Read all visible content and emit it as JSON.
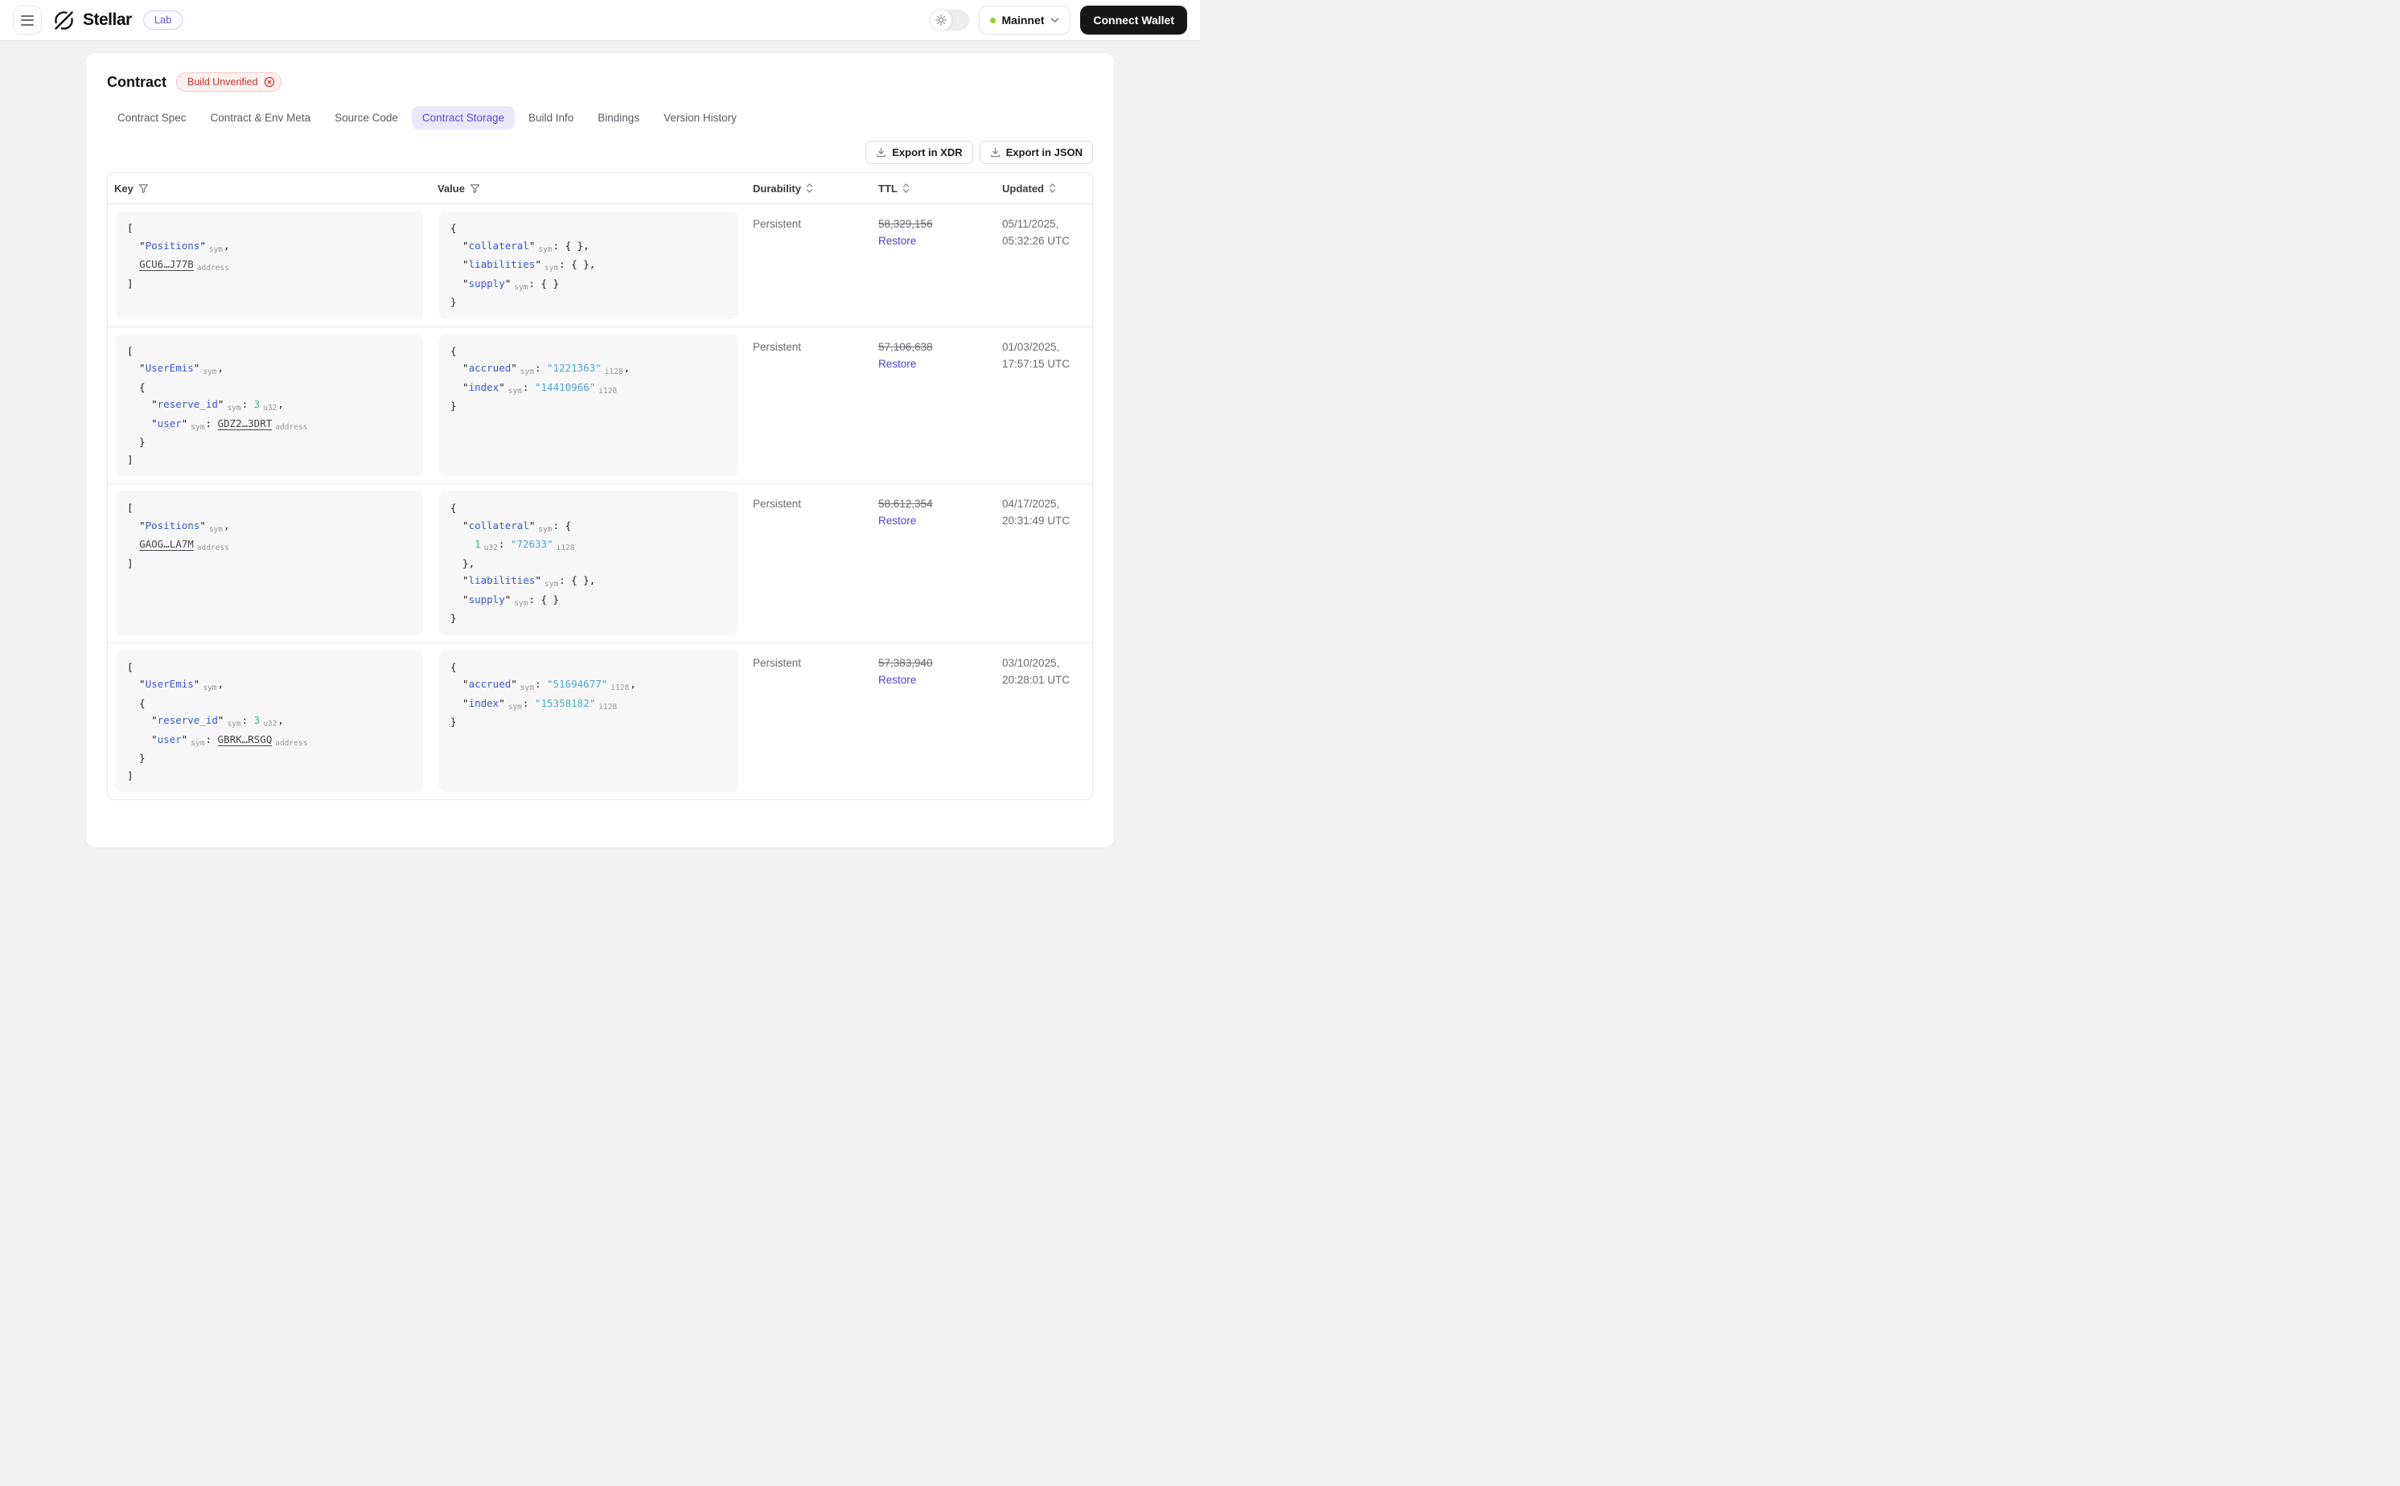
{
  "colors": {
    "accent_purple": "#5b49d6",
    "tab_active_bg": "#ece8fc",
    "key_blue": "#3a57c9",
    "string_cyan": "#4da6c9",
    "number_green": "#38b886",
    "restore_indigo": "#5143cb",
    "error_red": "#c1352f",
    "network_dot_green": "#94cf33",
    "wallet_button_bg": "#161616",
    "code_panel_bg": "#f7f7f7"
  },
  "header": {
    "brand": "Stellar",
    "badge": "Lab",
    "network_label": "Mainnet",
    "connect_wallet_label": "Connect Wallet"
  },
  "page": {
    "title": "Contract",
    "status_badge": "Build Unverified"
  },
  "tabs": {
    "items": [
      {
        "label": "Contract Spec"
      },
      {
        "label": "Contract & Env Meta"
      },
      {
        "label": "Source Code"
      },
      {
        "label": "Contract Storage"
      },
      {
        "label": "Build Info"
      },
      {
        "label": "Bindings"
      },
      {
        "label": "Version History"
      }
    ],
    "active": "Contract Storage"
  },
  "toolbar": {
    "export_xdr_label": "Export in XDR",
    "export_json_label": "Export in JSON"
  },
  "table": {
    "columns": [
      "Key",
      "Value",
      "Durability",
      "TTL",
      "Updated"
    ],
    "restore_label": "Restore",
    "rows": [
      {
        "key": [
          [
            [
              "p",
              "["
            ]
          ],
          [
            [
              "p",
              "  \""
            ],
            [
              "k",
              "Positions"
            ],
            [
              "p",
              "\""
            ],
            [
              "a",
              "sym"
            ],
            [
              "p",
              ","
            ]
          ],
          [
            [
              "p",
              "  "
            ],
            [
              "l",
              "GCU6…J77B"
            ],
            [
              "a",
              "address"
            ]
          ],
          [
            [
              "p",
              "]"
            ]
          ]
        ],
        "value": [
          [
            [
              "p",
              "{"
            ]
          ],
          [
            [
              "p",
              "  \""
            ],
            [
              "k",
              "collateral"
            ],
            [
              "p",
              "\""
            ],
            [
              "a",
              "sym"
            ],
            [
              "p",
              ": { },"
            ]
          ],
          [
            [
              "p",
              "  \""
            ],
            [
              "k",
              "liabilities"
            ],
            [
              "p",
              "\""
            ],
            [
              "a",
              "sym"
            ],
            [
              "p",
              ": { },"
            ]
          ],
          [
            [
              "p",
              "  \""
            ],
            [
              "k",
              "supply"
            ],
            [
              "p",
              "\""
            ],
            [
              "a",
              "sym"
            ],
            [
              "p",
              ": { }"
            ]
          ],
          [
            [
              "p",
              "}"
            ]
          ]
        ],
        "durability": "Persistent",
        "ttl": "58,329,156",
        "updated": [
          "05/11/2025,",
          "05:32:26 UTC"
        ]
      },
      {
        "key": [
          [
            [
              "p",
              "["
            ]
          ],
          [
            [
              "p",
              "  \""
            ],
            [
              "k",
              "UserEmis"
            ],
            [
              "p",
              "\""
            ],
            [
              "a",
              "sym"
            ],
            [
              "p",
              ","
            ]
          ],
          [
            [
              "p",
              "  {"
            ]
          ],
          [
            [
              "p",
              "    \""
            ],
            [
              "k",
              "reserve_id"
            ],
            [
              "p",
              "\""
            ],
            [
              "a",
              "sym"
            ],
            [
              "p",
              ": "
            ],
            [
              "n",
              "3"
            ],
            [
              "a",
              "u32"
            ],
            [
              "p",
              ","
            ]
          ],
          [
            [
              "p",
              "    \""
            ],
            [
              "k",
              "user"
            ],
            [
              "p",
              "\""
            ],
            [
              "a",
              "sym"
            ],
            [
              "p",
              ": "
            ],
            [
              "l",
              "GDZ2…3DRT"
            ],
            [
              "a",
              "address"
            ]
          ],
          [
            [
              "p",
              "  }"
            ]
          ],
          [
            [
              "p",
              "]"
            ]
          ]
        ],
        "value": [
          [
            [
              "p",
              "{"
            ]
          ],
          [
            [
              "p",
              "  \""
            ],
            [
              "k",
              "accrued"
            ],
            [
              "p",
              "\""
            ],
            [
              "a",
              "sym"
            ],
            [
              "p",
              ": "
            ],
            [
              "s",
              "\"1221363\""
            ],
            [
              "a",
              "i128"
            ],
            [
              "p",
              ","
            ]
          ],
          [
            [
              "p",
              "  \""
            ],
            [
              "k",
              "index"
            ],
            [
              "p",
              "\""
            ],
            [
              "a",
              "sym"
            ],
            [
              "p",
              ": "
            ],
            [
              "s",
              "\"14410966\""
            ],
            [
              "a",
              "i128"
            ]
          ],
          [
            [
              "p",
              "}"
            ]
          ]
        ],
        "durability": "Persistent",
        "ttl": "57,106,638",
        "updated": [
          "01/03/2025,",
          "17:57:15 UTC"
        ]
      },
      {
        "key": [
          [
            [
              "p",
              "["
            ]
          ],
          [
            [
              "p",
              "  \""
            ],
            [
              "k",
              "Positions"
            ],
            [
              "p",
              "\""
            ],
            [
              "a",
              "sym"
            ],
            [
              "p",
              ","
            ]
          ],
          [
            [
              "p",
              "  "
            ],
            [
              "l",
              "GAOG…LA7M"
            ],
            [
              "a",
              "address"
            ]
          ],
          [
            [
              "p",
              "]"
            ]
          ]
        ],
        "value": [
          [
            [
              "p",
              "{"
            ]
          ],
          [
            [
              "p",
              "  \""
            ],
            [
              "k",
              "collateral"
            ],
            [
              "p",
              "\""
            ],
            [
              "a",
              "sym"
            ],
            [
              "p",
              ": {"
            ]
          ],
          [
            [
              "p",
              "    "
            ],
            [
              "n",
              "1"
            ],
            [
              "a",
              "u32"
            ],
            [
              "p",
              ": "
            ],
            [
              "s",
              "\"72633\""
            ],
            [
              "a",
              "i128"
            ]
          ],
          [
            [
              "p",
              "  },"
            ]
          ],
          [
            [
              "p",
              "  \""
            ],
            [
              "k",
              "liabilities"
            ],
            [
              "p",
              "\""
            ],
            [
              "a",
              "sym"
            ],
            [
              "p",
              ": { },"
            ]
          ],
          [
            [
              "p",
              "  \""
            ],
            [
              "k",
              "supply"
            ],
            [
              "p",
              "\""
            ],
            [
              "a",
              "sym"
            ],
            [
              "p",
              ": { }"
            ]
          ],
          [
            [
              "p",
              "}"
            ]
          ]
        ],
        "durability": "Persistent",
        "ttl": "58,612,354",
        "updated": [
          "04/17/2025,",
          "20:31:49 UTC"
        ]
      },
      {
        "key": [
          [
            [
              "p",
              "["
            ]
          ],
          [
            [
              "p",
              "  \""
            ],
            [
              "k",
              "UserEmis"
            ],
            [
              "p",
              "\""
            ],
            [
              "a",
              "sym"
            ],
            [
              "p",
              ","
            ]
          ],
          [
            [
              "p",
              "  {"
            ]
          ],
          [
            [
              "p",
              "    \""
            ],
            [
              "k",
              "reserve_id"
            ],
            [
              "p",
              "\""
            ],
            [
              "a",
              "sym"
            ],
            [
              "p",
              ": "
            ],
            [
              "n",
              "3"
            ],
            [
              "a",
              "u32"
            ],
            [
              "p",
              ","
            ]
          ],
          [
            [
              "p",
              "    \""
            ],
            [
              "k",
              "user"
            ],
            [
              "p",
              "\""
            ],
            [
              "a",
              "sym"
            ],
            [
              "p",
              ": "
            ],
            [
              "l",
              "GBRK…RSGQ"
            ],
            [
              "a",
              "address"
            ]
          ],
          [
            [
              "p",
              "  }"
            ]
          ],
          [
            [
              "p",
              "]"
            ]
          ]
        ],
        "value": [
          [
            [
              "p",
              "{"
            ]
          ],
          [
            [
              "p",
              "  \""
            ],
            [
              "k",
              "accrued"
            ],
            [
              "p",
              "\""
            ],
            [
              "a",
              "sym"
            ],
            [
              "p",
              ": "
            ],
            [
              "s",
              "\"51694677\""
            ],
            [
              "a",
              "i128"
            ],
            [
              "p",
              ","
            ]
          ],
          [
            [
              "p",
              "  \""
            ],
            [
              "k",
              "index"
            ],
            [
              "p",
              "\""
            ],
            [
              "a",
              "sym"
            ],
            [
              "p",
              ": "
            ],
            [
              "s",
              "\"15358182\""
            ],
            [
              "a",
              "i128"
            ]
          ],
          [
            [
              "p",
              "}"
            ]
          ]
        ],
        "durability": "Persistent",
        "ttl": "57,383,940",
        "updated": [
          "03/10/2025,",
          "20:28:01 UTC"
        ]
      }
    ]
  }
}
